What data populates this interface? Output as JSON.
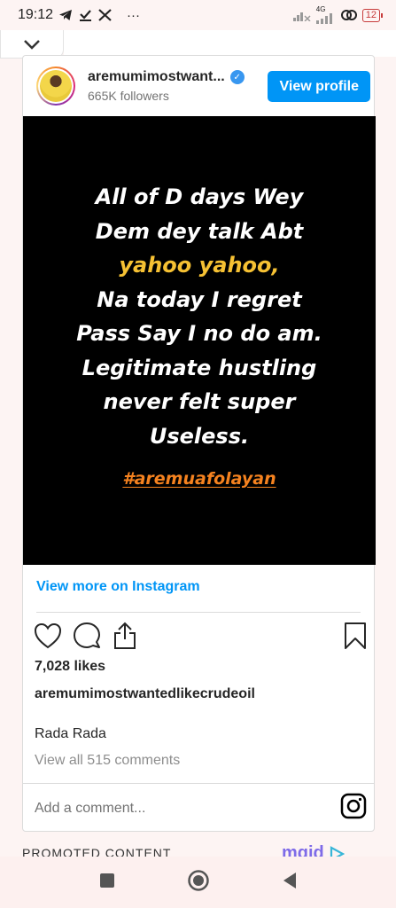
{
  "status_bar": {
    "time": "19:12",
    "left_icons": [
      "telegram-icon",
      "check-download-icon",
      "x-icon",
      "more-icon"
    ],
    "ellipsis": "···",
    "network": "4G",
    "battery": "12",
    "battery_color": "#c73b3b"
  },
  "embed": {
    "username": "aremumimostwant...",
    "verified": true,
    "followers": "665K followers",
    "view_profile_label": "View profile",
    "accent_color": "#0095f6",
    "post_text_lines": [
      {
        "text": "All of D days Wey",
        "color": "white"
      },
      {
        "text": "Dem dey talk Abt",
        "color": "white"
      },
      {
        "text": "yahoo yahoo,",
        "color": "yellow"
      },
      {
        "text": "Na today I regret",
        "color": "white"
      },
      {
        "text": "Pass Say I no do am.",
        "color": "white"
      },
      {
        "text": "Legitimate hustling",
        "color": "white"
      },
      {
        "text": "never felt super",
        "color": "white"
      },
      {
        "text": "Useless.",
        "color": "white"
      }
    ],
    "hashtag": "#aremuafolayan",
    "view_more": "View more on Instagram",
    "likes": "7,028 likes",
    "caption_username": "aremumimostwantedlikecrudeoil",
    "caption_text": "Rada Rada",
    "view_comments": "View all 515 comments",
    "comment_placeholder": "Add a comment..."
  },
  "promoted": {
    "label": "PROMOTED CONTENT",
    "ad_brand": "mgid"
  },
  "nav_bar": {
    "buttons": [
      "recents-button",
      "home-button",
      "back-button"
    ]
  }
}
